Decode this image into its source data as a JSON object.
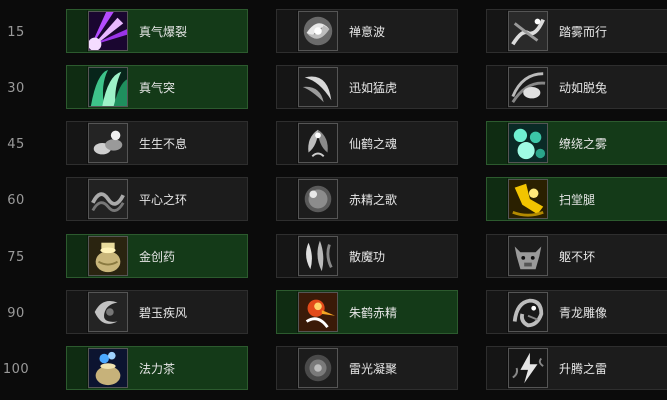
{
  "levels": [
    "15",
    "30",
    "45",
    "60",
    "75",
    "90",
    "100"
  ],
  "rows": [
    {
      "talents": [
        {
          "name": "真气爆裂",
          "selected": true,
          "icon": "purple-burst-icon"
        },
        {
          "name": "禅意波",
          "selected": false,
          "icon": "white-swirl-icon"
        },
        {
          "name": "踏雾而行",
          "selected": false,
          "icon": "mist-walk-icon"
        }
      ]
    },
    {
      "talents": [
        {
          "name": "真气突",
          "selected": true,
          "icon": "green-wave-icon"
        },
        {
          "name": "迅如猛虎",
          "selected": false,
          "icon": "tiger-swipe-icon"
        },
        {
          "name": "动如脱兔",
          "selected": false,
          "icon": "rabbit-dash-icon"
        }
      ]
    },
    {
      "talents": [
        {
          "name": "生生不息",
          "selected": false,
          "icon": "hands-life-icon"
        },
        {
          "name": "仙鹤之魂",
          "selected": false,
          "icon": "crane-spirit-icon"
        },
        {
          "name": "缭绕之雾",
          "selected": true,
          "icon": "teal-mist-orbs-icon"
        }
      ]
    },
    {
      "talents": [
        {
          "name": "平心之环",
          "selected": false,
          "icon": "calm-ring-icon"
        },
        {
          "name": "赤精之歌",
          "selected": false,
          "icon": "sphere-song-icon"
        },
        {
          "name": "扫堂腿",
          "selected": true,
          "icon": "leg-sweep-icon"
        }
      ]
    },
    {
      "talents": [
        {
          "name": "金创药",
          "selected": true,
          "icon": "healing-jar-icon"
        },
        {
          "name": "散魔功",
          "selected": false,
          "icon": "diffuse-magic-icon"
        },
        {
          "name": "躯不坏",
          "selected": false,
          "icon": "ox-statue-icon"
        }
      ]
    },
    {
      "talents": [
        {
          "name": "碧玉疾风",
          "selected": false,
          "icon": "jade-wind-icon"
        },
        {
          "name": "朱鹤赤精",
          "selected": true,
          "icon": "red-crane-icon"
        },
        {
          "name": "青龙雕像",
          "selected": false,
          "icon": "dragon-statue-icon"
        }
      ]
    },
    {
      "talents": [
        {
          "name": "法力茶",
          "selected": true,
          "icon": "mana-tea-icon"
        },
        {
          "name": "雷光凝聚",
          "selected": false,
          "icon": "thunder-focus-icon"
        },
        {
          "name": "升腾之雷",
          "selected": false,
          "icon": "rising-thunder-icon"
        }
      ]
    }
  ]
}
